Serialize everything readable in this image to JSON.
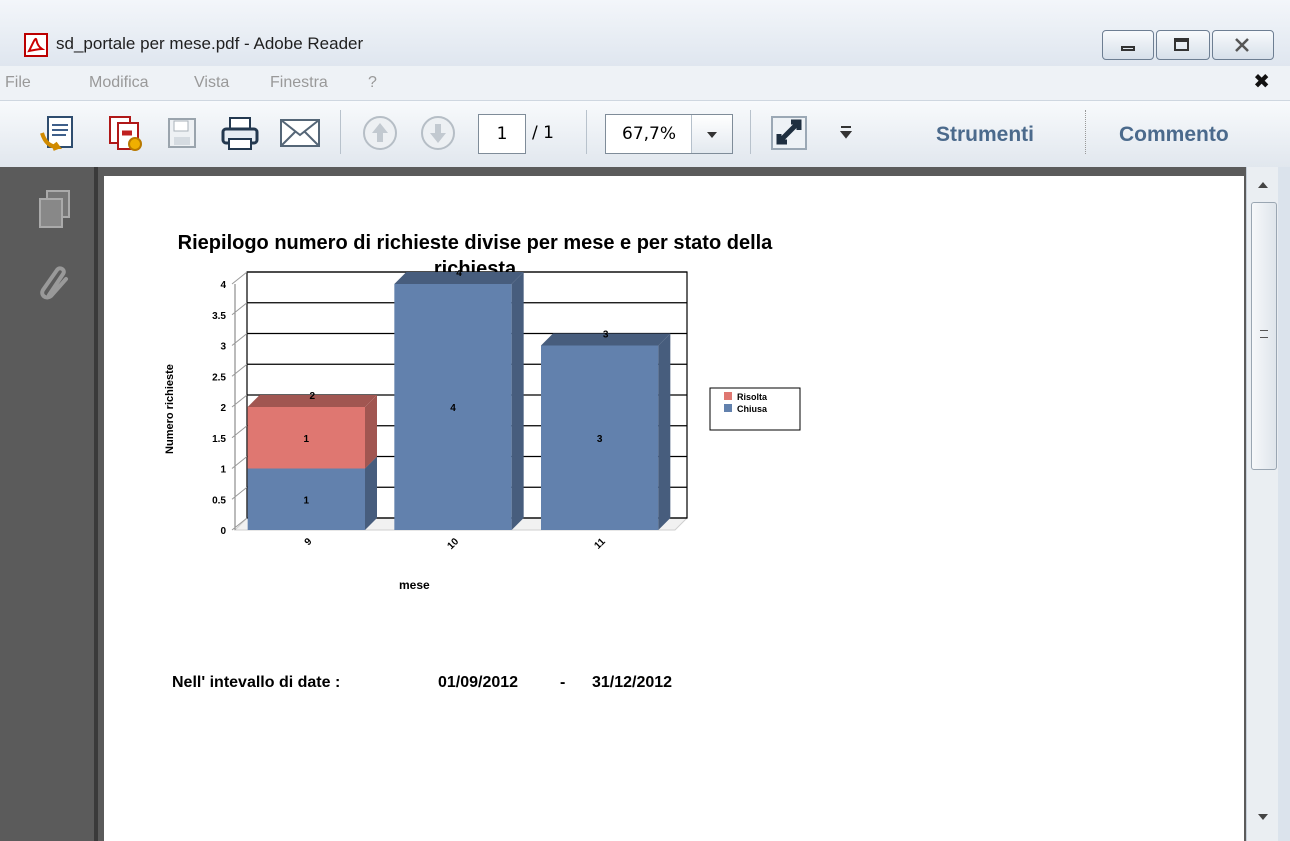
{
  "window": {
    "title": "sd_portale per mese.pdf - Adobe Reader"
  },
  "menu": {
    "items": [
      "File",
      "Modifica",
      "Vista",
      "Finestra",
      "?"
    ]
  },
  "toolbar": {
    "page_current": "1",
    "page_total": "/ 1",
    "zoom": "67,7%",
    "tools_label": "Strumenti",
    "comment_label": "Commento"
  },
  "document": {
    "footer_label": "Nell' intevallo di date :",
    "date_from": "01/09/2012",
    "date_separator": "-",
    "date_to": "31/12/2012"
  },
  "colors": {
    "risolta": "#df7771",
    "chiusa": "#6281ad",
    "accent": "#4b6a8c"
  },
  "chart_data": {
    "type": "bar",
    "stacked": true,
    "title": "Riepilogo numero di richieste divise per mese e per stato della richiesta",
    "xlabel": "mese",
    "ylabel": "Numero richieste",
    "categories": [
      "9",
      "10",
      "11"
    ],
    "series": [
      {
        "name": "Chiusa",
        "values": [
          1,
          4,
          3
        ]
      },
      {
        "name": "Risolta",
        "values": [
          1,
          0,
          0
        ]
      }
    ],
    "totals": [
      2,
      4,
      3
    ],
    "ylim": [
      0,
      4
    ],
    "yticks": [
      "0",
      "0.5",
      "1",
      "1.5",
      "2",
      "2.5",
      "3",
      "3.5",
      "4"
    ],
    "legend_position": "right",
    "grid": true
  }
}
